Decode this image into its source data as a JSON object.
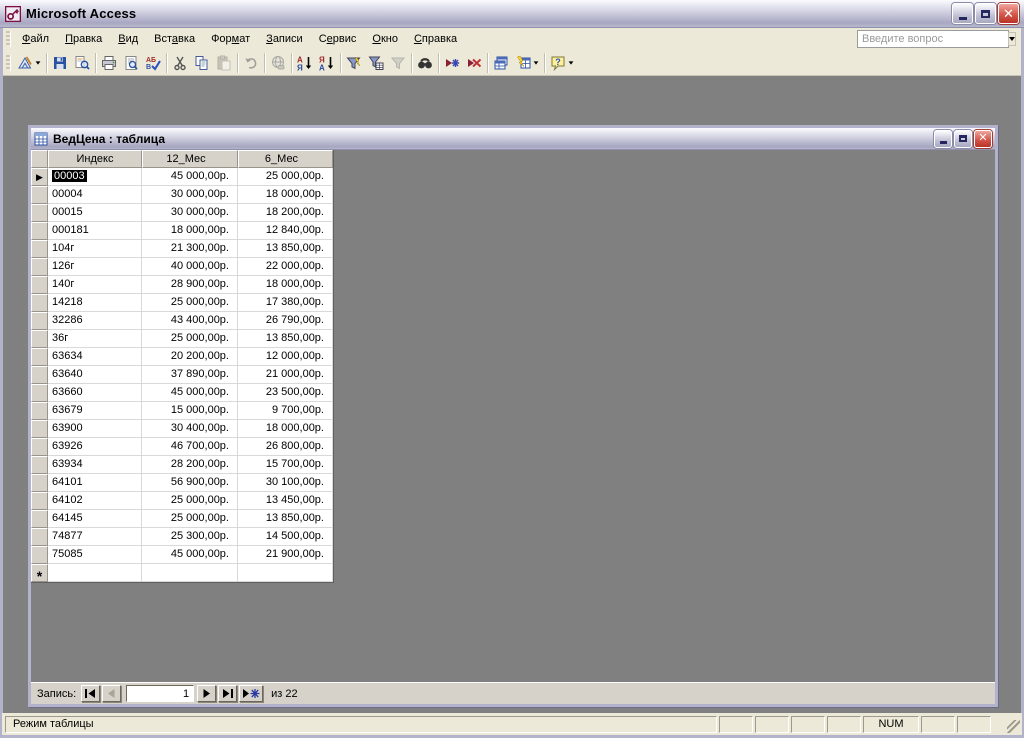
{
  "colors": {
    "titlebar_top": "#fbfbfe",
    "titlebar_bottom": "#a7a7c2",
    "close_button": "#c0392e",
    "workspace": "#808080",
    "button_face": "#ece9d8",
    "grid_line": "#d9d9d9",
    "selection_bg": "#000000",
    "selection_fg": "#ffffff"
  },
  "window": {
    "title": "Microsoft Access"
  },
  "menu": {
    "items": [
      {
        "label": "Файл",
        "u": 0
      },
      {
        "label": "Правка",
        "u": 0
      },
      {
        "label": "Вид",
        "u": 0
      },
      {
        "label": "Вставка",
        "u": 3
      },
      {
        "label": "Формат",
        "u": 3
      },
      {
        "label": "Записи",
        "u": 0
      },
      {
        "label": "Сервис",
        "u": 1
      },
      {
        "label": "Окно",
        "u": 0
      },
      {
        "label": "Справка",
        "u": 0
      }
    ],
    "question_placeholder": "Введите вопрос"
  },
  "toolbar": {
    "buttons": [
      "view-datasheet",
      "save",
      "file-search",
      "print",
      "print-preview",
      "spelling",
      "cut",
      "copy",
      "paste",
      "undo",
      "insert-hyperlink",
      "sort-ascending",
      "sort-descending",
      "filter-by-selection",
      "filter-by-form",
      "apply-filter",
      "find",
      "new-record",
      "delete-record",
      "database-window",
      "new-object",
      "help"
    ]
  },
  "document_window": {
    "title": "ВедЦена : таблица",
    "table": {
      "columns": [
        "Индекс",
        "12_Мес",
        "6_Мес"
      ],
      "rows": [
        [
          "00003",
          "45 000,00р.",
          "25 000,00р."
        ],
        [
          "00004",
          "30 000,00р.",
          "18 000,00р."
        ],
        [
          "00015",
          "30 000,00р.",
          "18 200,00р."
        ],
        [
          "000181",
          "18 000,00р.",
          "12 840,00р."
        ],
        [
          "104г",
          "21 300,00р.",
          "13 850,00р."
        ],
        [
          "126г",
          "40 000,00р.",
          "22 000,00р."
        ],
        [
          "140г",
          "28 900,00р.",
          "18 000,00р."
        ],
        [
          "14218",
          "25 000,00р.",
          "17 380,00р."
        ],
        [
          "32286",
          "43 400,00р.",
          "26 790,00р."
        ],
        [
          "36г",
          "25 000,00р.",
          "13 850,00р."
        ],
        [
          "63634",
          "20 200,00р.",
          "12 000,00р."
        ],
        [
          "63640",
          "37 890,00р.",
          "21 000,00р."
        ],
        [
          "63660",
          "45 000,00р.",
          "23 500,00р."
        ],
        [
          "63679",
          "15 000,00р.",
          "9 700,00р."
        ],
        [
          "63900",
          "30 400,00р.",
          "18 000,00р."
        ],
        [
          "63926",
          "46 700,00р.",
          "26 800,00р."
        ],
        [
          "63934",
          "28 200,00р.",
          "15 700,00р."
        ],
        [
          "64101",
          "56 900,00р.",
          "30 100,00р."
        ],
        [
          "64102",
          "25 000,00р.",
          "13 450,00р."
        ],
        [
          "64145",
          "25 000,00р.",
          "13 850,00р."
        ],
        [
          "74877",
          "25 300,00р.",
          "14 500,00р."
        ],
        [
          "75085",
          "45 000,00р.",
          "21 900,00р."
        ]
      ],
      "selected_row": 0,
      "selected_col": 0
    },
    "record_nav": {
      "label": "Запись:",
      "current": "1",
      "total_label": "из 22"
    }
  },
  "status_bar": {
    "mode": "Режим таблицы",
    "num": "NUM"
  }
}
